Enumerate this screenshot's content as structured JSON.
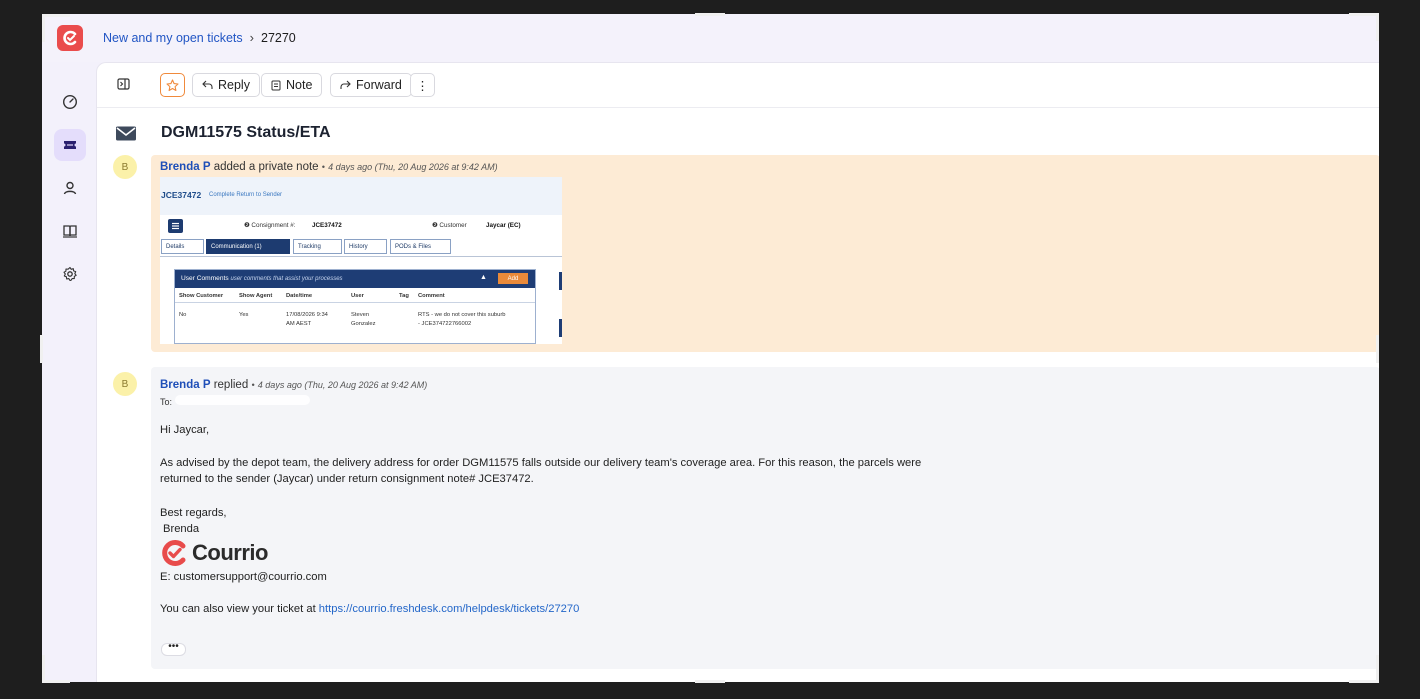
{
  "breadcrumb": {
    "parent": "New and my open tickets",
    "separator": "›",
    "current": "27270"
  },
  "toolbar": {
    "reply": "Reply",
    "note": "Note",
    "forward": "Forward",
    "more": "⋮"
  },
  "ticket": {
    "title": "DGM11575 Status/ETA"
  },
  "note": {
    "avatar": "B",
    "author": "Brenda P",
    "action": "added a private note",
    "dot": "•",
    "time": "4 days ago (Thu, 20 Aug 2026 at 9:42 AM)",
    "screenshot": {
      "consignment": "JCE37472",
      "consignment_status": "Complete Return to Sender",
      "consignment_label": "❷ Consignment #:",
      "consignment_value": "JCE37472",
      "customer_label": "❷ Customer",
      "customer_value": "Jaycar (EC)",
      "tabs": [
        "Details",
        "Communication (1)",
        "Tracking",
        "History",
        "PODs & Files"
      ],
      "panel_title": "User Comments",
      "panel_subtitle": "user comments that assist your processes",
      "add_label": "Add",
      "columns": [
        "Show Customer",
        "Show Agent",
        "Date/time",
        "User",
        "Tag",
        "Comment"
      ],
      "row": {
        "show_customer": "No",
        "show_agent": "Yes",
        "datetime_1": "17/08/2026 9:34",
        "datetime_2": "AM AEST",
        "user_1": "Steven",
        "user_2": "Gonzalez",
        "comment_1": "RTS - we do not cover this suburb",
        "comment_2": "- JCE374722766002"
      }
    }
  },
  "reply": {
    "avatar": "B",
    "author": "Brenda P",
    "action": "replied",
    "dot": "•",
    "time": "4 days ago (Thu, 20 Aug 2026 at 9:42 AM)",
    "to": "To:",
    "greeting": "Hi Jaycar,",
    "paragraph_1": "As advised by the depot team, the delivery address for order DGM11575 falls outside our delivery team's coverage area. For this reason, the parcels were",
    "paragraph_2": "returned to the sender (Jaycar) under return consignment note# JCE37472.",
    "signoff": "Best regards,",
    "name": "Brenda",
    "brand": "Courrio",
    "email": "E: customersupport@courrio.com",
    "view_prefix": "You can also view your ticket at ",
    "view_link": "https://courrio.freshdesk.com/helpdesk/tickets/27270",
    "ellipsis": "•••"
  },
  "colors": {
    "accent": "#ea4c4c",
    "link": "#2155c4",
    "note_bg": "#fdebd5",
    "reply_bg": "#f4f5f8"
  }
}
